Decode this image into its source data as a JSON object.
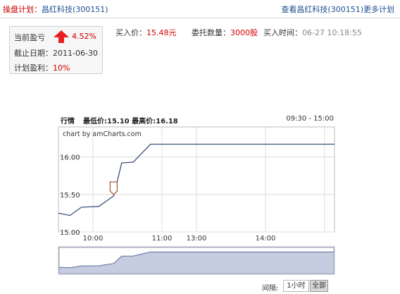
{
  "header": {
    "plan_label": "操盘计划：",
    "stock_name": "昌红科技(300151)",
    "more_link": "查看昌红科技(300151)更多计划"
  },
  "summary": {
    "pl_label": "当前盈亏",
    "pl_value": "4.52%",
    "deadline_label": "截止日期：",
    "deadline_value": "2011-06-30",
    "target_label": "计划盈利：",
    "target_value": "10%"
  },
  "order": {
    "buy_price_label": "买入价：",
    "buy_price_value": "15.48元",
    "qty_label": "委托数量：",
    "qty_value": "3000股",
    "time_label": "买入时间：",
    "time_value": "06-27 10:18:55"
  },
  "chart_header": {
    "title": "行情",
    "range_text": "最低价:15.10 最高价:16.18",
    "hours": "09:30 - 15:00"
  },
  "chart_data": {
    "type": "line",
    "credit": "chart by amCharts.com",
    "x_domain": [
      "09:30",
      "15:00"
    ],
    "x_ticks": [
      "10:00",
      "11:00",
      "13:00",
      "14:00"
    ],
    "y_ticks": [
      15.0,
      15.5,
      16.0
    ],
    "ylim": [
      15.0,
      16.4
    ],
    "grid": true,
    "series": [
      {
        "points": [
          {
            "x": "09:30",
            "y": 15.25
          },
          {
            "x": "09:40",
            "y": 15.22
          },
          {
            "x": "09:50",
            "y": 15.33
          },
          {
            "x": "10:05",
            "y": 15.34
          },
          {
            "x": "10:18",
            "y": 15.48
          },
          {
            "x": "10:25",
            "y": 15.92
          },
          {
            "x": "10:35",
            "y": 15.93
          },
          {
            "x": "10:50",
            "y": 16.17
          },
          {
            "x": "15:00",
            "y": 16.17
          }
        ]
      }
    ],
    "buy_marker": {
      "x": "10:18",
      "y": 15.48
    },
    "colors": {
      "line": "#39507a",
      "navigator_fill": "#c6cde0",
      "navigator_line": "#5b6aa0",
      "grid": "#dcdcdc",
      "marker": "#a0522d"
    }
  },
  "controls": {
    "interval_label": "间隔:",
    "btn_1h": "1小时",
    "btn_all": "全部"
  },
  "colors": {
    "red": "#d40000",
    "blue_link": "#1d4f91"
  }
}
